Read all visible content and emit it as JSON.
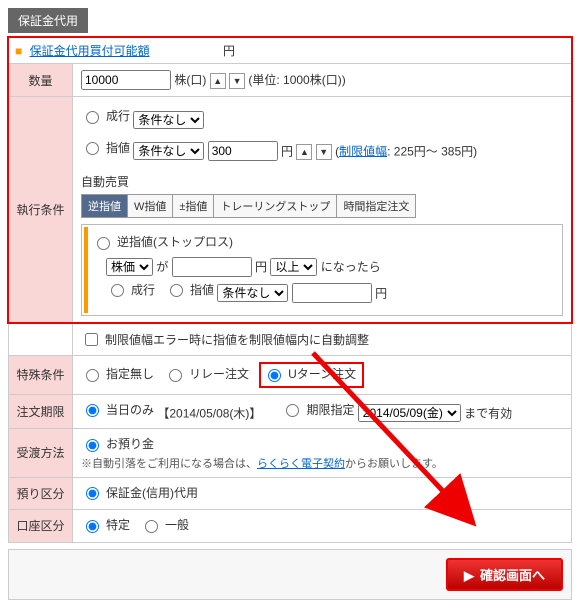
{
  "section_title": "保証金代用",
  "top": {
    "link_label": "保証金代用買付可能額",
    "unit": "円"
  },
  "qty": {
    "label": "数量",
    "value": "10000",
    "unit_label": "株(口)",
    "unit_note": "(単位: 1000株(口))"
  },
  "exec": {
    "label": "執行条件",
    "market_label": "成行",
    "market_cond_options": [
      "条件なし"
    ],
    "limit_label": "指値",
    "limit_cond_options": [
      "条件なし"
    ],
    "limit_value": "300",
    "limit_unit": "円",
    "limit_range_label": "制限値幅",
    "limit_range_text": ": 225円～ 385円",
    "auto_header": "自動売買",
    "tabs": [
      "逆指値",
      "W指値",
      "±指値",
      "トレーリングストップ",
      "時間指定注文"
    ],
    "active_tab_index": 0,
    "sub_title": "逆指値(ストップロス)",
    "sub_price_type_options": [
      "株価"
    ],
    "sub_ga": "が",
    "sub_unit": "円",
    "sub_cond_options": [
      "以上"
    ],
    "sub_trail": "になったら",
    "sub_market_label": "成行",
    "sub_limit_label": "指値",
    "sub_limit_cond_options": [
      "条件なし"
    ],
    "sub_limit_unit": "円"
  },
  "auto_adjust": {
    "note": "制限値幅エラー時に指値を制限値幅内に自動調整"
  },
  "special": {
    "label": "特殊条件",
    "opt_none": "指定無し",
    "opt_relay": "リレー注文",
    "opt_uturn": "Uターン注文"
  },
  "period": {
    "label": "注文期限",
    "today_label": "当日のみ",
    "today_value": "【2014/05/08(木)】",
    "exp_label": "期限指定",
    "exp_options": [
      "2014/05/09(金)"
    ],
    "exp_trail": "まで有効"
  },
  "delivery": {
    "label": "受渡方法",
    "opt_deposit": "お預り金",
    "note_pre": "※自動引落をご利用になる場合は、",
    "note_link": "らくらく電子契約",
    "note_post": "からお願いします。"
  },
  "deposit_class": {
    "label": "預り区分",
    "opt_margin": "保証金(信用)代用"
  },
  "account_class": {
    "label": "口座区分",
    "opt_specific": "特定",
    "opt_general": "一般"
  },
  "confirm_label": "確認画面へ"
}
